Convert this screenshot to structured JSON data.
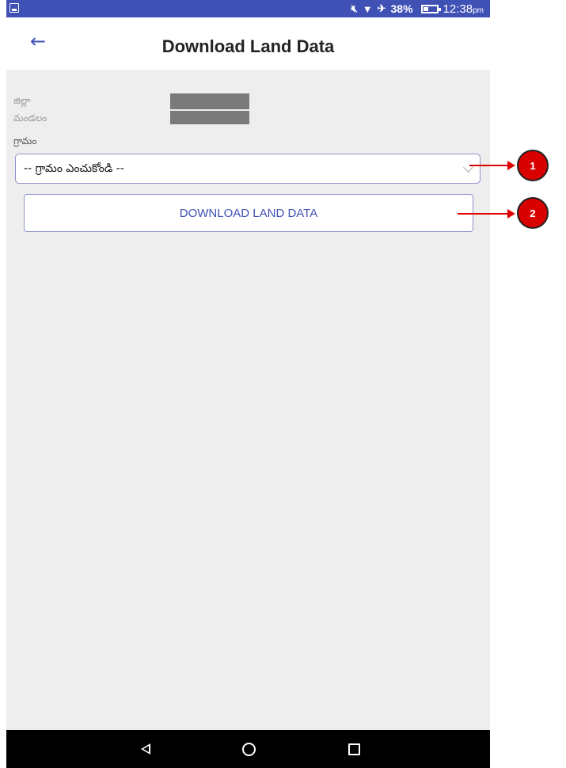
{
  "status_bar": {
    "battery": "38%",
    "time": "12:38",
    "ampm": "pm",
    "icons": [
      "gallery-icon",
      "mute-icon",
      "wifi-icon",
      "airplane-icon",
      "battery-icon"
    ]
  },
  "app_bar": {
    "back_icon": "arrow-left-icon",
    "title": "Download Land Data"
  },
  "form": {
    "district_label": "జిల్లా",
    "mandal_label": "మండలం",
    "village_label": "గ్రామం",
    "village_select_value": "-- గ్రామం ఎంచుకోండి --",
    "download_button": "DOWNLOAD LAND DATA"
  },
  "nav_bar": {
    "icons": [
      "nav-back-icon",
      "nav-home-icon",
      "nav-recents-icon"
    ]
  },
  "annotations": {
    "badge_1": "1",
    "badge_2": "2",
    "color": "#e00000"
  },
  "colors": {
    "accent": "#3f51b5",
    "content_bg": "#eeeeee"
  }
}
